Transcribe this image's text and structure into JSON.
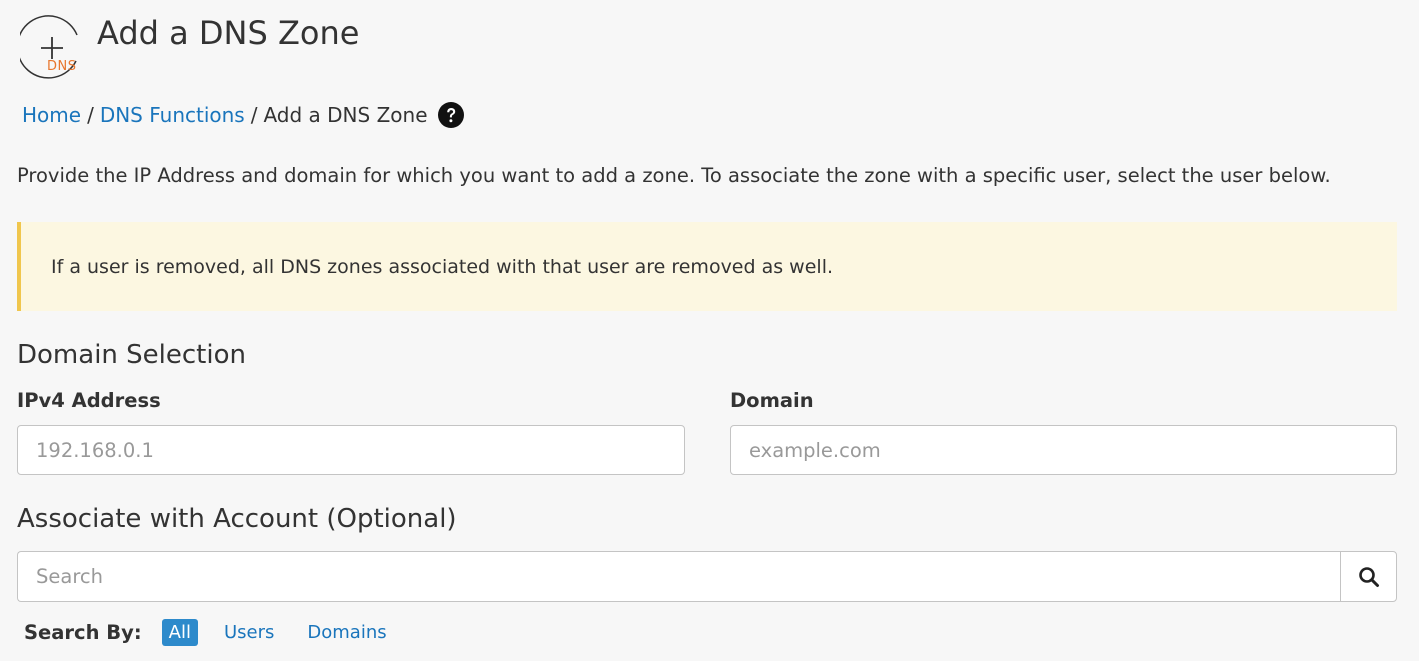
{
  "header": {
    "logo_text": "DNS",
    "logo_icon": "plus-icon",
    "title": "Add a DNS Zone"
  },
  "breadcrumb": {
    "items": [
      "Home",
      "DNS Functions"
    ],
    "current": "Add a DNS Zone",
    "separator": "/",
    "help_icon": "question-circle-icon"
  },
  "intro": "Provide the IP Address and domain for which you want to add a zone. To associate the zone with a specific user, select the user below.",
  "alert": {
    "text": "If a user is removed, all DNS zones associated with that user are removed as well.",
    "accent_color": "#f0c64d",
    "background": "#fcf7e1"
  },
  "domain_selection": {
    "title": "Domain Selection",
    "ipv4_label": "IPv4 Address",
    "ipv4_placeholder": "192.168.0.1",
    "ipv4_value": "",
    "domain_label": "Domain",
    "domain_placeholder": "example.com",
    "domain_value": ""
  },
  "account": {
    "title": "Associate with Account (Optional)",
    "search_placeholder": "Search",
    "search_value": "",
    "search_icon": "search-icon",
    "search_by_label": "Search By:",
    "options": [
      "All",
      "Users",
      "Domains"
    ],
    "active_option": "All"
  },
  "colors": {
    "link": "#1a75bc",
    "active_pill": "#2d8acb",
    "logo_accent": "#e8772e"
  }
}
